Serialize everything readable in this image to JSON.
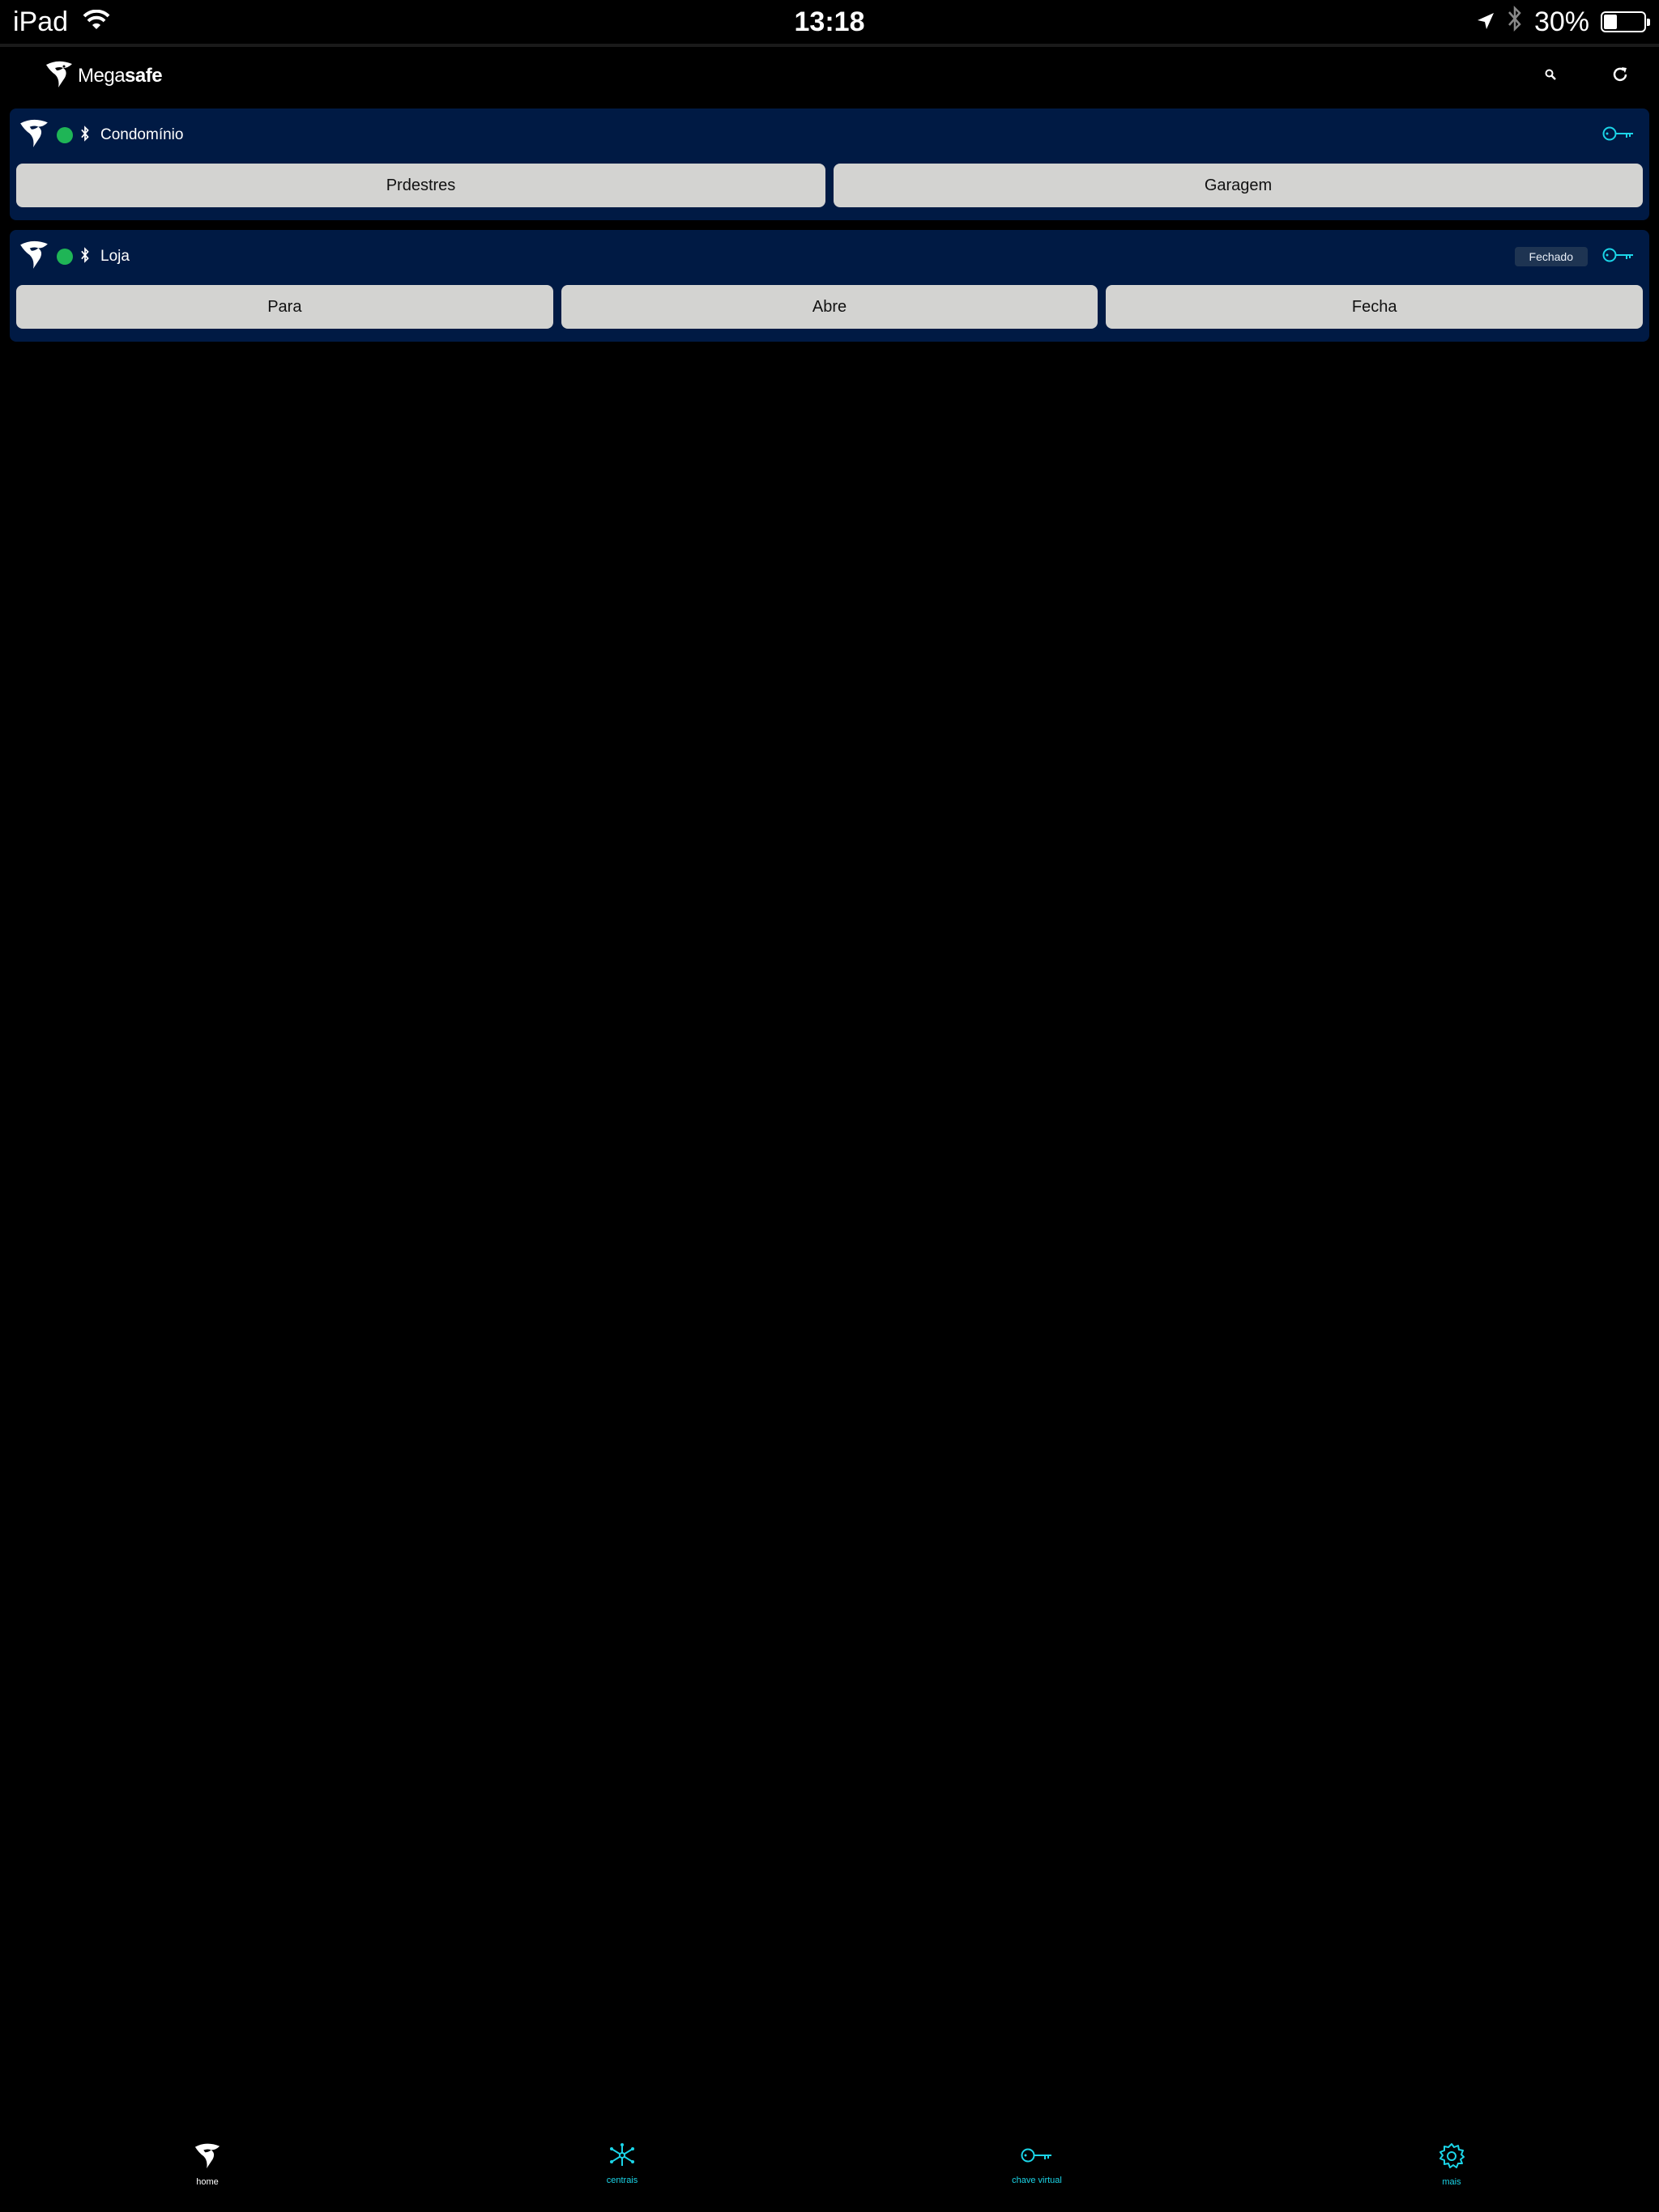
{
  "status_bar": {
    "device": "iPad",
    "time": "13:18",
    "battery": "30%",
    "battery_level": 0.3
  },
  "header": {
    "logo_text_regular": "Mega",
    "logo_text_bold": "safe"
  },
  "cards": [
    {
      "title": "Condomínio",
      "online": true,
      "buttons": [
        "Prdestres",
        "Garagem"
      ]
    },
    {
      "title": "Loja",
      "online": true,
      "badge": "Fechado",
      "buttons": [
        "Para",
        "Abre",
        "Fecha"
      ]
    }
  ],
  "tabs": [
    {
      "label": "home",
      "icon": "eagle-icon",
      "active": true
    },
    {
      "label": "centrais",
      "icon": "network-icon",
      "active": false
    },
    {
      "label": "chave virtual",
      "icon": "key-icon",
      "active": false
    },
    {
      "label": "mais",
      "icon": "gear-icon",
      "active": false
    }
  ],
  "colors": {
    "card_bg": "#001a44",
    "accent": "#1bd5e8",
    "online": "#1fb556",
    "button_bg": "#d3d3d1"
  }
}
